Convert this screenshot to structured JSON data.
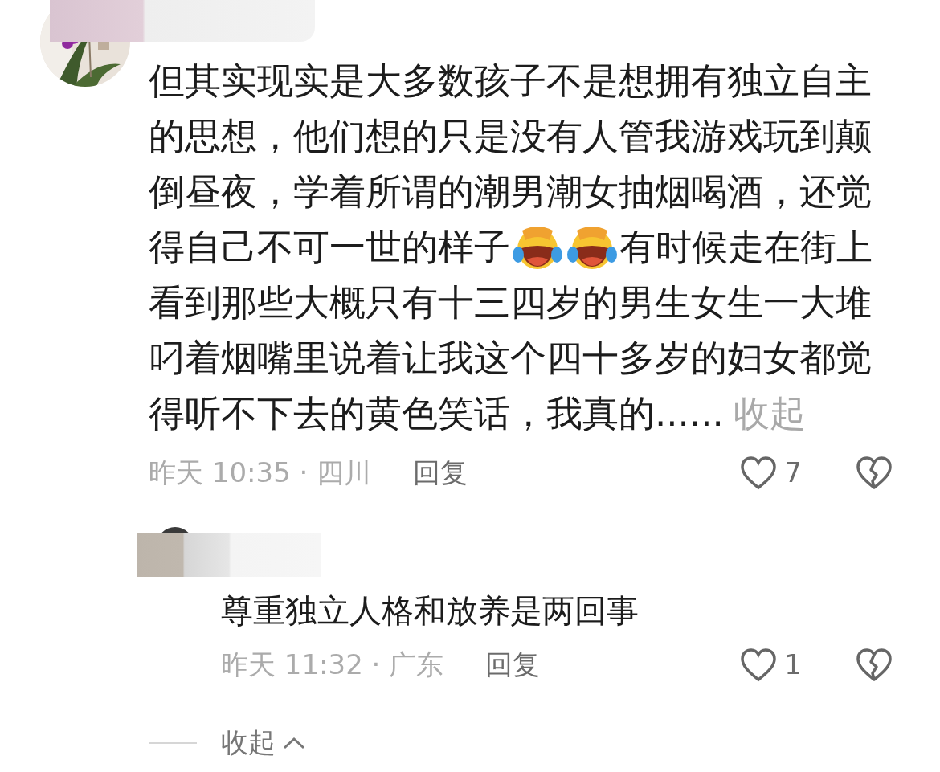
{
  "comment": {
    "avatar": {
      "kind": "picture"
    },
    "lines": [
      [
        {
          "kind": "text",
          "text": "但其实现实是大多数孩子不是想拥有独立自主的思想，他们想的只是没有人管我游戏玩到颠倒昼夜，学着所谓的潮男潮女抽烟喝酒，还觉"
        }
      ],
      [
        {
          "kind": "text",
          "text": "得自己不可一世的样子"
        },
        {
          "kind": "emoji"
        },
        {
          "kind": "emoji"
        },
        {
          "kind": "text",
          "text": "有时候走在街上"
        }
      ],
      [
        {
          "kind": "text",
          "text": "看到那些大概只有十三四岁的男生女生一大堆叼着烟嘴里说着让我这个四十多岁的妇女都觉"
        }
      ],
      [
        {
          "kind": "text",
          "text": "得听不下去的黄色笑话，我真的......"
        },
        {
          "kind": "link",
          "text": "收起"
        }
      ]
    ],
    "meta": "昨天 10:35 · 四川",
    "reply": "回复",
    "likes": "7"
  },
  "reply": {
    "text": "尊重独立人格和放养是两回事",
    "meta": "昨天 11:32 · 广东",
    "reply": "回复",
    "likes": "1"
  },
  "collapse": {
    "label": "收起"
  }
}
